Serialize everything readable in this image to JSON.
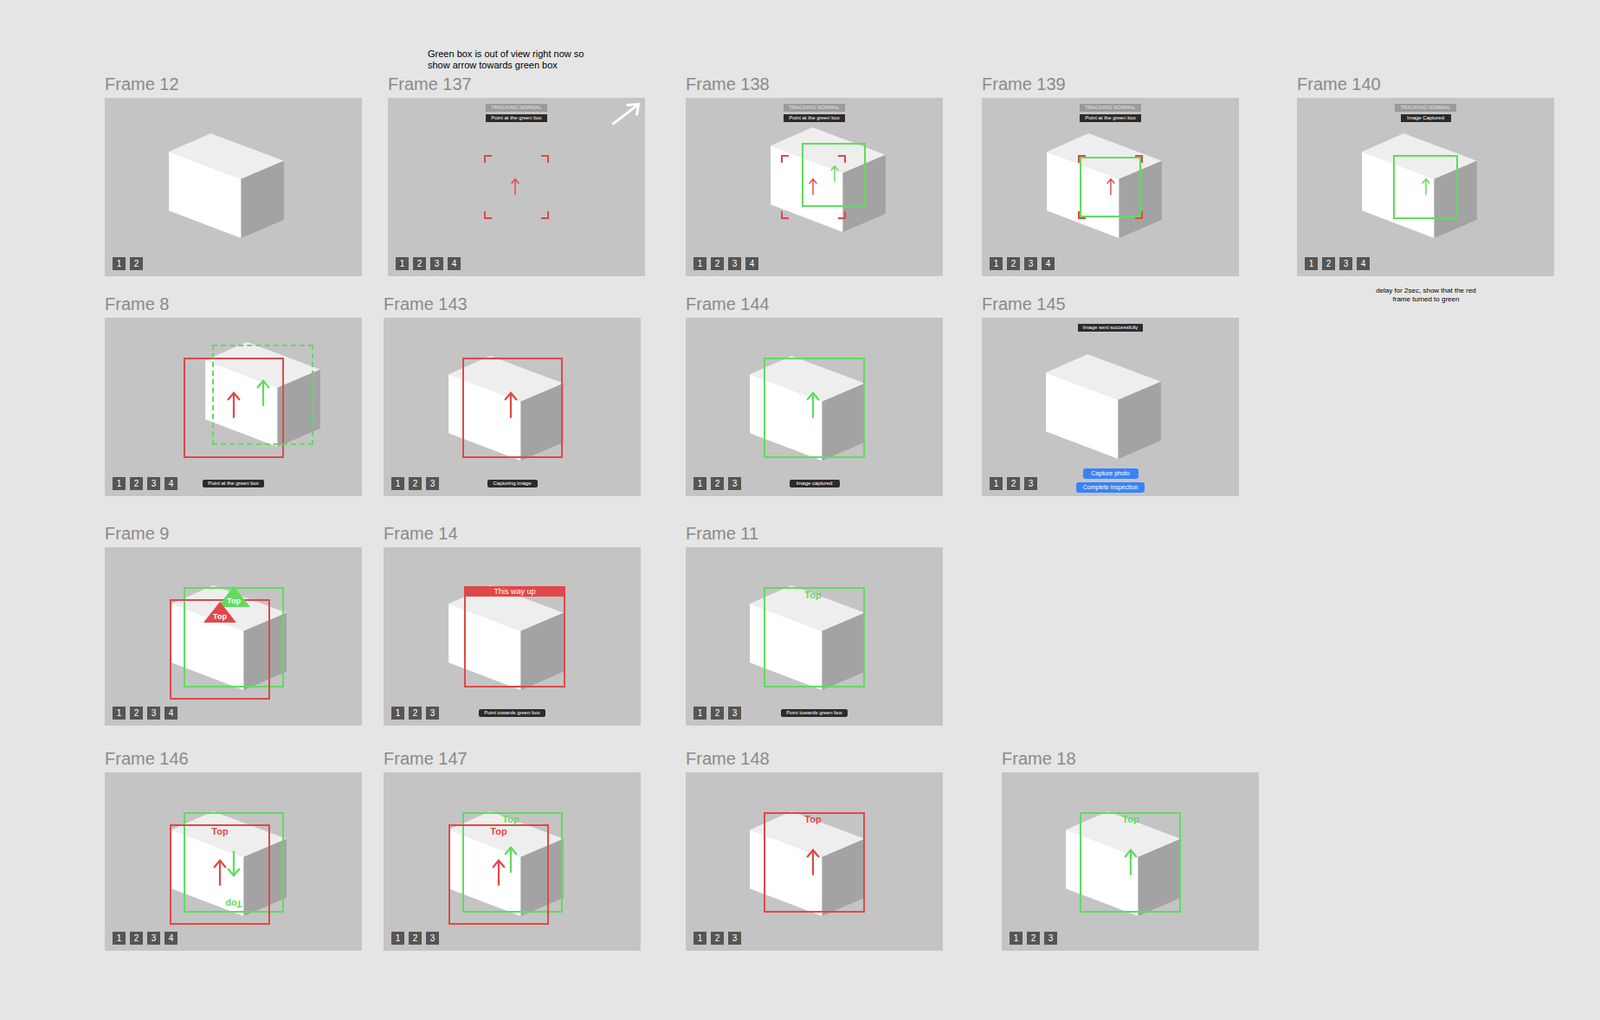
{
  "annotations": [
    {
      "text": "Green box is out of view right now so show arrow towards green box"
    },
    {
      "text": "delay for 2sec, show that the red frame turned to green"
    }
  ],
  "frames": [
    {
      "title": "Frame 12",
      "box_visible": true,
      "top_pills": [],
      "bottom_pills": [],
      "buttons": [],
      "badges": [
        "1",
        "2"
      ],
      "overlays": []
    },
    {
      "title": "Frame 137",
      "box_visible": false,
      "top_pills": [
        {
          "text": "TRACKING NORMAL",
          "kind": "status"
        },
        {
          "text": "Point at the green box",
          "kind": "instruction"
        }
      ],
      "bottom_pills": [],
      "buttons": [],
      "badges": [
        "1",
        "2",
        "3",
        "4"
      ],
      "overlays": [
        {
          "kind": "corners",
          "color": "#e04848"
        },
        {
          "kind": "arrow",
          "color": "#e04848",
          "flipped": false
        },
        {
          "kind": "pointer",
          "color": "#ffffff"
        }
      ]
    },
    {
      "title": "Frame 138",
      "box_visible": true,
      "top_pills": [
        {
          "text": "TRACKING NORMAL",
          "kind": "status"
        },
        {
          "text": "Point at the green box",
          "kind": "instruction"
        }
      ],
      "bottom_pills": [],
      "buttons": [],
      "badges": [
        "1",
        "2",
        "3",
        "4"
      ],
      "overlays": [
        {
          "kind": "corners",
          "color": "#e04848"
        },
        {
          "kind": "rect",
          "color": "#5fdc5f",
          "dashed": false
        },
        {
          "kind": "arrow",
          "color": "#e04848",
          "flipped": false
        },
        {
          "kind": "arrow",
          "color": "#5fdc5f",
          "flipped": false
        }
      ]
    },
    {
      "title": "Frame 139",
      "box_visible": true,
      "top_pills": [
        {
          "text": "TRACKING NORMAL",
          "kind": "status"
        },
        {
          "text": "Point at the green box",
          "kind": "instruction"
        }
      ],
      "bottom_pills": [],
      "buttons": [],
      "badges": [
        "1",
        "2",
        "3",
        "4"
      ],
      "overlays": [
        {
          "kind": "corners",
          "color": "#e04848"
        },
        {
          "kind": "rect",
          "color": "#5fdc5f",
          "dashed": false
        },
        {
          "kind": "arrow",
          "color": "#e04848",
          "flipped": false
        }
      ]
    },
    {
      "title": "Frame 140",
      "box_visible": true,
      "top_pills": [
        {
          "text": "TRACKING NORMAL",
          "kind": "status"
        },
        {
          "text": "Image Captured",
          "kind": "instruction"
        }
      ],
      "bottom_pills": [],
      "buttons": [],
      "badges": [
        "1",
        "2",
        "3",
        "4"
      ],
      "overlays": [
        {
          "kind": "rect",
          "color": "#5fdc5f",
          "dashed": false
        },
        {
          "kind": "arrow",
          "color": "#5fdc5f",
          "flipped": false
        }
      ]
    },
    {
      "title": "Frame 8",
      "box_visible": true,
      "top_pills": [],
      "bottom_pills": [
        {
          "text": "Point at the green box"
        }
      ],
      "buttons": [],
      "badges": [
        "1",
        "2",
        "3",
        "4"
      ],
      "overlays": [
        {
          "kind": "rect",
          "color": "#e04848",
          "dashed": false
        },
        {
          "kind": "rect",
          "color": "#5fdc5f",
          "dashed": true
        },
        {
          "kind": "arrow",
          "color": "#e04848",
          "flipped": false
        },
        {
          "kind": "arrow",
          "color": "#5fdc5f",
          "flipped": false
        }
      ]
    },
    {
      "title": "Frame 143",
      "box_visible": true,
      "top_pills": [],
      "bottom_pills": [
        {
          "text": "Capturing image"
        }
      ],
      "buttons": [],
      "badges": [
        "1",
        "2",
        "3"
      ],
      "overlays": [
        {
          "kind": "rect",
          "color": "#e04848",
          "dashed": false
        },
        {
          "kind": "arrow",
          "color": "#e04848",
          "flipped": false
        }
      ]
    },
    {
      "title": "Frame 144",
      "box_visible": true,
      "top_pills": [],
      "bottom_pills": [
        {
          "text": "Image captured"
        }
      ],
      "buttons": [],
      "badges": [
        "1",
        "2",
        "3"
      ],
      "overlays": [
        {
          "kind": "rect",
          "color": "#5fdc5f",
          "dashed": false
        },
        {
          "kind": "arrow",
          "color": "#5fdc5f",
          "flipped": false
        }
      ]
    },
    {
      "title": "Frame 145",
      "box_visible": true,
      "top_pills": [
        {
          "text": "Image sent successfully",
          "kind": "instruction"
        }
      ],
      "bottom_pills": [],
      "buttons": [
        "Capture photo",
        "Complete inspection"
      ],
      "badges": [
        "1",
        "2",
        "3"
      ],
      "overlays": []
    },
    {
      "title": "Frame 9",
      "box_visible": true,
      "top_pills": [],
      "bottom_pills": [],
      "buttons": [],
      "badges": [
        "1",
        "2",
        "3",
        "4"
      ],
      "overlays": [
        {
          "kind": "rect",
          "color": "#5fdc5f",
          "dashed": false
        },
        {
          "kind": "rect",
          "color": "#e04848",
          "dashed": false
        },
        {
          "kind": "marker",
          "text": "Top",
          "color": "#5fdc5f"
        },
        {
          "kind": "marker",
          "text": "Top",
          "color": "#e04848"
        }
      ]
    },
    {
      "title": "Frame 14",
      "box_visible": true,
      "top_pills": [],
      "bottom_pills": [
        {
          "text": "Point towards green box"
        }
      ],
      "buttons": [],
      "badges": [
        "1",
        "2",
        "3"
      ],
      "overlays": [
        {
          "kind": "rect",
          "color": "#5fdc5f",
          "dashed": false
        },
        {
          "kind": "rect",
          "color": "#e04848",
          "dashed": false
        },
        {
          "kind": "banner",
          "text": "This way up",
          "color": "#e04848"
        }
      ]
    },
    {
      "title": "Frame 11",
      "box_visible": true,
      "top_pills": [],
      "bottom_pills": [
        {
          "text": "Point towards green box"
        }
      ],
      "buttons": [],
      "badges": [
        "1",
        "2",
        "3"
      ],
      "overlays": [
        {
          "kind": "rect",
          "color": "#5fdc5f",
          "dashed": false
        },
        {
          "kind": "label",
          "text": "Top",
          "color": "#5fdc5f",
          "flipped": false
        }
      ]
    },
    {
      "title": "Frame 146",
      "box_visible": true,
      "top_pills": [],
      "bottom_pills": [],
      "buttons": [],
      "badges": [
        "1",
        "2",
        "3",
        "4"
      ],
      "overlays": [
        {
          "kind": "rect",
          "color": "#5fdc5f",
          "dashed": false
        },
        {
          "kind": "rect",
          "color": "#e04848",
          "dashed": false
        },
        {
          "kind": "label",
          "text": "Top",
          "color": "#e04848",
          "flipped": false
        },
        {
          "kind": "arrow",
          "color": "#e04848",
          "flipped": false
        },
        {
          "kind": "arrow",
          "color": "#5fdc5f",
          "flipped": true
        },
        {
          "kind": "label",
          "text": "Top",
          "color": "#5fdc5f",
          "flipped": true
        }
      ]
    },
    {
      "title": "Frame 147",
      "box_visible": true,
      "top_pills": [],
      "bottom_pills": [],
      "buttons": [],
      "badges": [
        "1",
        "2",
        "3"
      ],
      "overlays": [
        {
          "kind": "rect",
          "color": "#5fdc5f",
          "dashed": false
        },
        {
          "kind": "rect",
          "color": "#e04848",
          "dashed": false
        },
        {
          "kind": "label",
          "text": "Top",
          "color": "#5fdc5f",
          "flipped": false
        },
        {
          "kind": "label",
          "text": "Top",
          "color": "#e04848",
          "flipped": false
        },
        {
          "kind": "arrow",
          "color": "#e04848",
          "flipped": false
        },
        {
          "kind": "arrow",
          "color": "#5fdc5f",
          "flipped": false
        }
      ]
    },
    {
      "title": "Frame 148",
      "box_visible": true,
      "top_pills": [],
      "bottom_pills": [],
      "buttons": [],
      "badges": [
        "1",
        "2",
        "3"
      ],
      "overlays": [
        {
          "kind": "rect",
          "color": "#e04848",
          "dashed": false
        },
        {
          "kind": "label",
          "text": "Top",
          "color": "#e04848",
          "flipped": false
        },
        {
          "kind": "arrow",
          "color": "#e04848",
          "flipped": false
        }
      ]
    },
    {
      "title": "Frame 18",
      "box_visible": true,
      "top_pills": [],
      "bottom_pills": [],
      "buttons": [],
      "badges": [
        "1",
        "2",
        "3"
      ],
      "overlays": [
        {
          "kind": "rect",
          "color": "#5fdc5f",
          "dashed": false
        },
        {
          "kind": "label",
          "text": "Top",
          "color": "#5fdc5f",
          "flipped": false
        },
        {
          "kind": "arrow",
          "color": "#5fdc5f",
          "flipped": false
        }
      ]
    }
  ]
}
